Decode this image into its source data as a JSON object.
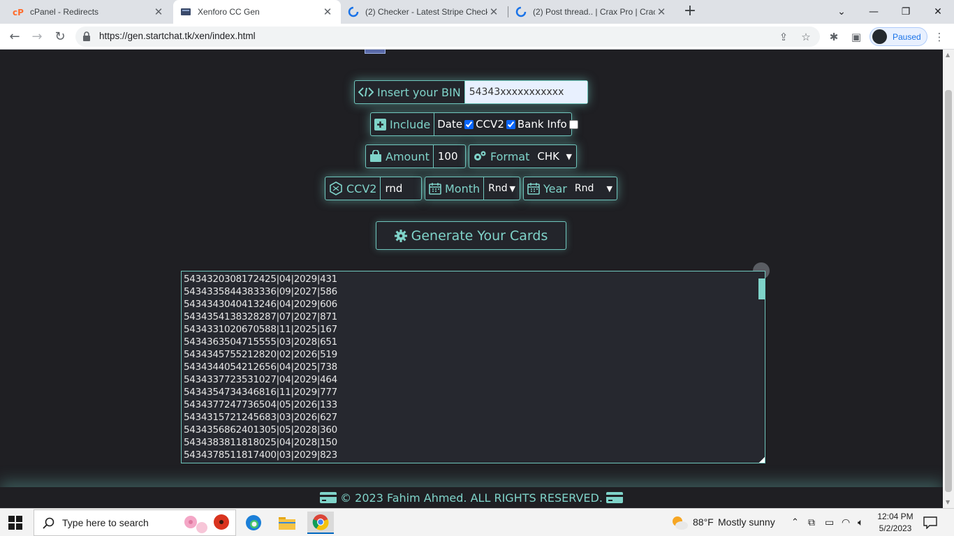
{
  "browser": {
    "tabs": [
      {
        "title": "cPanel - Redirects",
        "active": false
      },
      {
        "title": "Xenforo CC Gen",
        "active": true
      },
      {
        "title": "(2) Checker - Latest Stripe Checker",
        "active": false
      },
      {
        "title": "(2) Post thread.. | Crax Pro | Crack",
        "active": false
      }
    ],
    "url": "https://gen.startchat.tk/xen/index.html",
    "profile_label": "Paused"
  },
  "form": {
    "bin_label": "Insert your BIN",
    "bin_value": "54343xxxxxxxxxxx",
    "include_label": "Include",
    "date_label": "Date",
    "date_checked": true,
    "ccv2_opt_label": "CCV2",
    "ccv2_checked": true,
    "bank_label": "Bank Info",
    "bank_checked": false,
    "amount_label": "Amount",
    "amount_value": "100",
    "format_label": "Format",
    "format_value": "CHK",
    "ccv2_label": "CCV2",
    "ccv2_value": "rnd",
    "month_label": "Month",
    "month_value": "Rnd",
    "year_label": "Year",
    "year_value": "Rnd",
    "generate_label": "Generate Your Cards"
  },
  "output_lines": [
    "5434320308172425|04|2029|431",
    "5434335844383336|09|2027|586",
    "5434343040413246|04|2029|606",
    "5434354138328287|07|2027|871",
    "5434331020670588|11|2025|167",
    "5434363504715555|03|2028|651",
    "5434345755212820|02|2026|519",
    "5434344054212656|04|2025|738",
    "5434337723531027|04|2029|464",
    "5434354734346816|11|2029|777",
    "5434377247736504|05|2026|133",
    "5434315721245683|03|2026|627",
    "5434356862401305|05|2028|360",
    "5434383811818025|04|2028|150",
    "5434378511817400|03|2029|823"
  ],
  "footer_text": "© 2023 Fahim Ahmed. ALL RIGHTS RESERVED.",
  "taskbar": {
    "search_placeholder": "Type here to search",
    "weather_temp": "88°F",
    "weather_desc": "Mostly sunny",
    "time": "12:04 PM",
    "date": "5/2/2023"
  },
  "colors": {
    "accent": "#7fd3c9",
    "page_bg": "#1f1f23",
    "input_bg": "#e8f0fe"
  }
}
